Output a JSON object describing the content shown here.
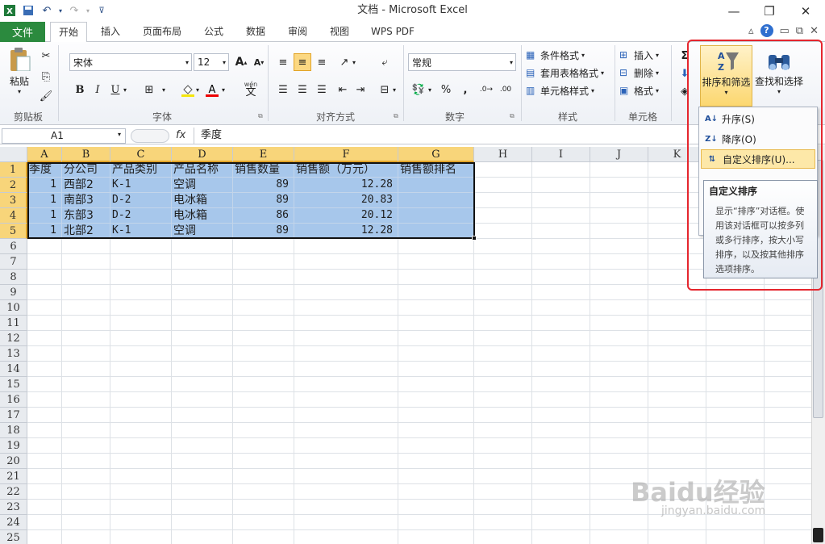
{
  "window": {
    "title": "文档 - Microsoft Excel",
    "controls": [
      "—",
      "❐",
      "✕"
    ]
  },
  "ribbon_tabs": [
    "文件",
    "开始",
    "插入",
    "页面布局",
    "公式",
    "数据",
    "审阅",
    "视图",
    "WPS PDF"
  ],
  "active_tab": "开始",
  "clipboard": {
    "paste_label": "粘贴",
    "group_label": "剪贴板"
  },
  "font": {
    "name": "宋体",
    "size": "12",
    "bold": "B",
    "italic": "I",
    "underline": "U",
    "grow": "A",
    "shrink": "A",
    "wen": "wén",
    "group_label": "字体"
  },
  "alignment": {
    "group_label": "对齐方式"
  },
  "number": {
    "format": "常规",
    "percent": "%",
    "comma": ",",
    "group_label": "数字"
  },
  "styles": {
    "conditional": "条件格式",
    "table_format": "套用表格格式",
    "cell_style": "单元格样式",
    "group_label": "样式"
  },
  "cells": {
    "insert": "插入",
    "delete": "删除",
    "format": "格式",
    "group_label": "单元格"
  },
  "editing": {
    "sigma": "Σ",
    "sort_filter": "排序和筛选",
    "find_select": "查找和选择"
  },
  "formula_bar": {
    "name_box": "A1",
    "fx": "fx",
    "content": "季度"
  },
  "columns": [
    "A",
    "B",
    "C",
    "D",
    "E",
    "F",
    "G",
    "H",
    "I",
    "J",
    "K"
  ],
  "rows": [
    "1",
    "2",
    "3",
    "4",
    "5",
    "6",
    "7",
    "8",
    "9",
    "10",
    "11",
    "12",
    "13",
    "14",
    "15",
    "16",
    "17",
    "18",
    "19",
    "20",
    "21",
    "22",
    "23",
    "24",
    "25"
  ],
  "sheet": {
    "header": [
      "季度",
      "分公司",
      "产品类别",
      "产品名称",
      "销售数量",
      "销售额（万元）",
      "销售额排名"
    ],
    "data": [
      [
        "1",
        "西部2",
        "K-1",
        "空调",
        "89",
        "12.28",
        ""
      ],
      [
        "1",
        "南部3",
        "D-2",
        "电冰箱",
        "89",
        "20.83",
        ""
      ],
      [
        "1",
        "东部3",
        "D-2",
        "电冰箱",
        "86",
        "20.12",
        ""
      ],
      [
        "1",
        "北部2",
        "K-1",
        "空调",
        "89",
        "12.28",
        ""
      ]
    ]
  },
  "sort_menu": {
    "ascending": "升序(S)",
    "descending": "降序(O)",
    "custom": "自定义排序(U)..."
  },
  "tooltip": {
    "title": "自定义排序",
    "body": "显示“排序”对话框。使用该对话框可以按多列或多行排序，按大小写排序，以及按其他排序选项排序。"
  },
  "watermark": {
    "brand": "Baidu经验",
    "url": "jingyan.baidu.com"
  }
}
